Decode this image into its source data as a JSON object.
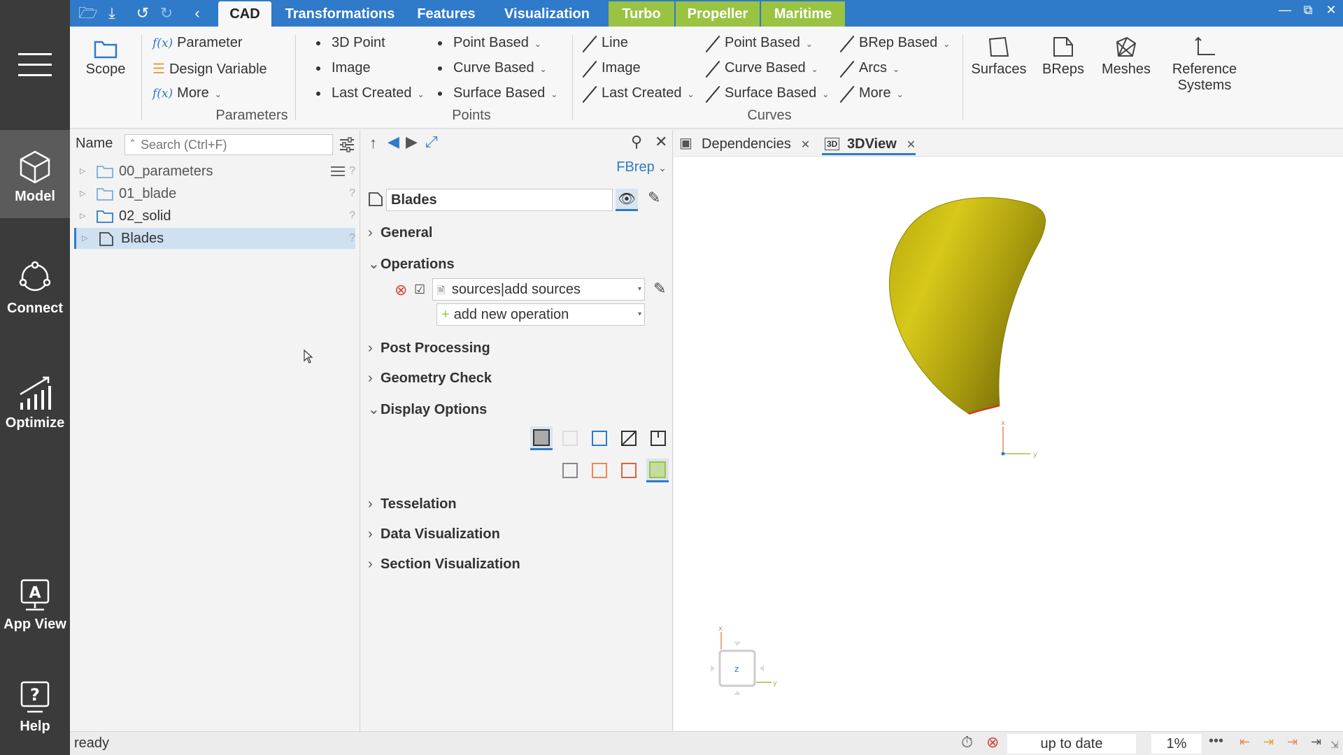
{
  "sidebar": {
    "items": [
      {
        "label": "Model",
        "icon": "cube-icon"
      },
      {
        "label": "Connect",
        "icon": "connect-icon"
      },
      {
        "label": "Optimize",
        "icon": "chart-icon"
      },
      {
        "label": "App View",
        "icon": "app-view-icon"
      },
      {
        "label": "Help",
        "icon": "help-icon"
      }
    ]
  },
  "topbar": {
    "tabs": [
      "CAD",
      "Transformations",
      "Features",
      "Visualization",
      "Turbo",
      "Propeller",
      "Maritime"
    ],
    "accent": "#2f7ac9",
    "green": "#9ac342"
  },
  "ribbon": {
    "scope": "Scope",
    "parameters": {
      "items": [
        "Parameter",
        "Design Variable",
        "More"
      ],
      "fx": "f(x)",
      "group": "Parameters"
    },
    "points": {
      "col1": [
        "3D Point",
        "Image",
        "Last Created"
      ],
      "col2": [
        "Point Based",
        "Curve Based",
        "Surface Based"
      ],
      "group": "Points"
    },
    "curves": {
      "col1": [
        "Line",
        "Image",
        "Last Created"
      ],
      "col2": [
        "Point Based",
        "Curve Based",
        "Surface Based"
      ],
      "col3": [
        "BRep Based",
        "Arcs",
        "More"
      ],
      "group": "Curves"
    },
    "big": [
      "Surfaces",
      "BReps",
      "Meshes",
      "Reference",
      "Systems"
    ]
  },
  "tree": {
    "header": "Name",
    "search_placeholder": "Search (Ctrl+F)",
    "rows": [
      "00_parameters",
      "01_blade",
      "02_solid",
      "Blades"
    ],
    "q": "?"
  },
  "props": {
    "type": "FBrep",
    "name": "Blades",
    "sections": {
      "general": "General",
      "operations": "Operations",
      "post": "Post Processing",
      "geomcheck": "Geometry Check",
      "display": "Display Options",
      "tess": "Tesselation",
      "datavis": "Data Visualization",
      "secvis": "Section Visualization"
    },
    "operation": "sources|add sources",
    "add_op": "add new operation",
    "plus": "+"
  },
  "viewtabs": [
    "Dependencies",
    "3DView"
  ],
  "status": {
    "ready": "ready",
    "uptodate": "up to date",
    "percent": "1%"
  }
}
